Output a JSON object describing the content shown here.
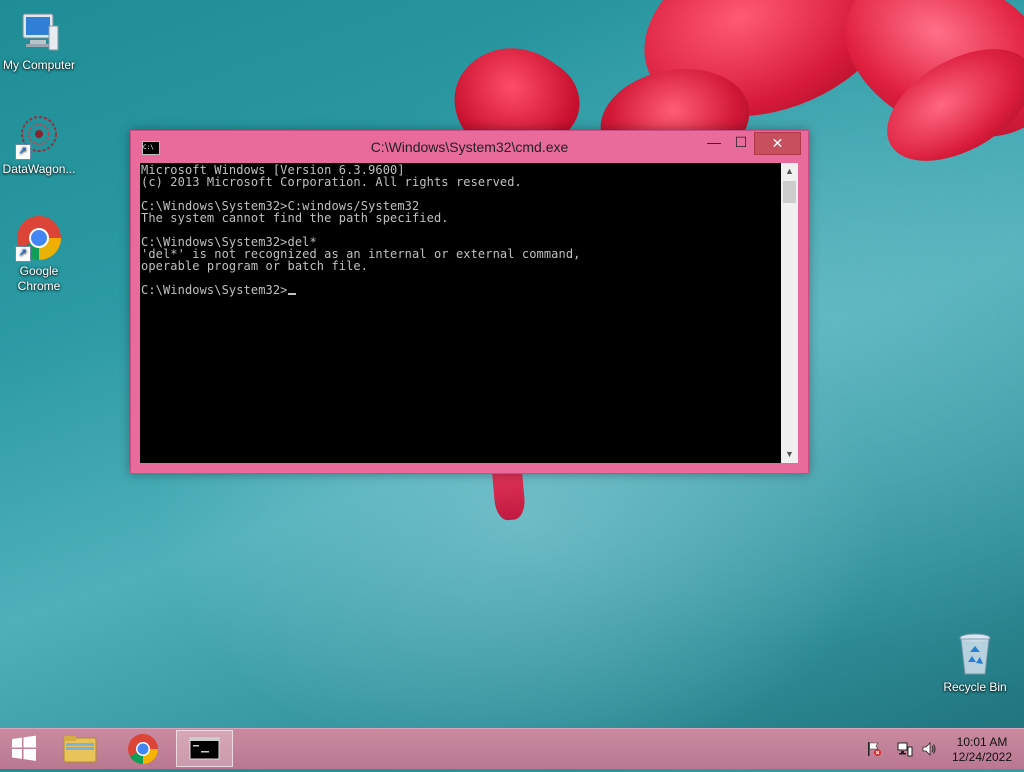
{
  "desktop": {
    "icons": [
      {
        "label": "My Computer"
      },
      {
        "label": "DataWagon..."
      },
      {
        "label": "Google Chrome"
      },
      {
        "label": "Recycle Bin"
      }
    ]
  },
  "cmd_window": {
    "title": "C:\\Windows\\System32\\cmd.exe",
    "icon_text": "C:\\",
    "controls": {
      "minimize": "—",
      "maximize": "☐",
      "close": "✕"
    },
    "scroll_up": "▲",
    "scroll_down": "▼",
    "console_lines": [
      "Microsoft Windows [Version 6.3.9600]",
      "(c) 2013 Microsoft Corporation. All rights reserved.",
      "",
      "C:\\Windows\\System32>C:windows/System32",
      "The system cannot find the path specified.",
      "",
      "C:\\Windows\\System32>del*",
      "'del*' is not recognized as an internal or external command,",
      "operable program or batch file.",
      "",
      "C:\\Windows\\System32>"
    ]
  },
  "taskbar": {
    "apps": [
      "start-button",
      "file-explorer",
      "google-chrome",
      "command-prompt"
    ],
    "active_app": "command-prompt",
    "clock": {
      "time": "10:01 AM",
      "date": "12/24/2022"
    }
  },
  "colors": {
    "window_frame": "#e86b9c",
    "taskbar": "#c98aa0",
    "console_bg": "#000000",
    "console_fg": "#c0c0c0",
    "close_button": "#c7505f"
  }
}
